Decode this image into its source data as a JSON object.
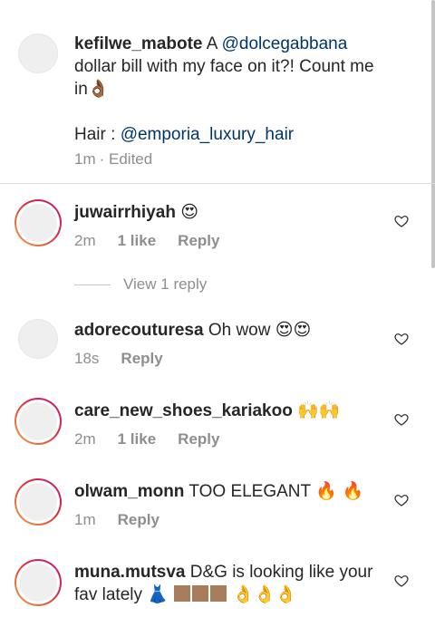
{
  "caption": {
    "username": "kefilwe_mabote",
    "text_before": "A ",
    "mention1": "@dolcegabbana",
    "text_after": " dollar bill with my face on it?! Count me in",
    "emoji": "👌🏾",
    "hair_label": "Hair : ",
    "mention2": "@emporia_luxury_hair",
    "time": "1m",
    "edited": "· Edited"
  },
  "comments": [
    {
      "username": "juwairrhiyah",
      "text": "",
      "emoji": "😍",
      "time": "2m",
      "likes": "1 like",
      "reply": "Reply"
    },
    {
      "username": "adorecouturesa",
      "text": " Oh wow ",
      "emoji": "😍😍",
      "time": "18s",
      "likes": "",
      "reply": "Reply"
    },
    {
      "username": "care_new_shoes_kariakoo",
      "text": " ",
      "emoji": "🙌🙌",
      "time": "2m",
      "likes": "1 like",
      "reply": "Reply"
    },
    {
      "username": "olwam_monn",
      "text": " TOO ELEGANT ",
      "emoji": "🔥 🔥",
      "time": "1m",
      "likes": "",
      "reply": "Reply"
    },
    {
      "username": "muna.mutsva",
      "text": " D&G is looking like your fav lately ",
      "emoji": "👗",
      "time": "",
      "likes": "",
      "reply": ""
    }
  ],
  "view_reply": "View 1 reply",
  "colors": {
    "mention": "#003569",
    "meta": "#8e8e8e",
    "divider": "#dbdbdb"
  }
}
